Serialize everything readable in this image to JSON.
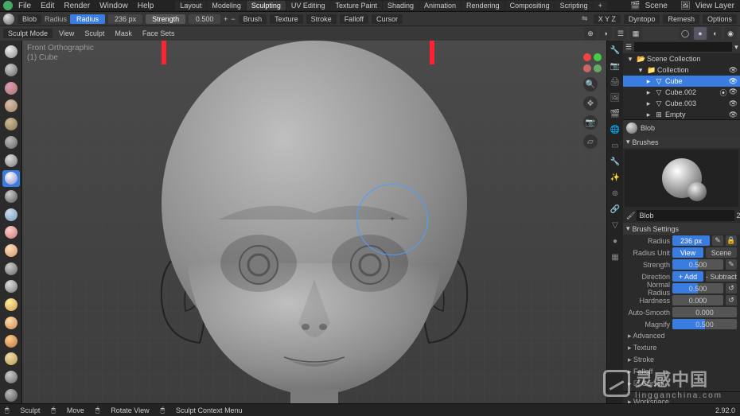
{
  "menu": {
    "items": [
      "File",
      "Edit",
      "Render",
      "Window",
      "Help"
    ]
  },
  "workspaces": {
    "tabs": [
      "Layout",
      "Modeling",
      "Sculpting",
      "UV Editing",
      "Texture Paint",
      "Shading",
      "Animation",
      "Rendering",
      "Compositing",
      "Scripting"
    ],
    "active": "Sculpting"
  },
  "topright": {
    "scene_label": "Scene",
    "scene": "Scene",
    "layer_label": "View Layer",
    "layer": "View Layer"
  },
  "toolhdr": {
    "mode": "Sculpt Mode",
    "menus": [
      "View",
      "Sculpt",
      "Mask",
      "Face Sets"
    ],
    "brush_name": "Blob",
    "radius_label": "Radius",
    "radius_value": "236 px",
    "strength_label": "Strength",
    "strength_value": "0.500",
    "dropdowns": [
      "Brush",
      "Texture",
      "Stroke",
      "Falloff",
      "Cursor"
    ],
    "xyz": "X Y Z",
    "dyntopo": "Dyntopo",
    "remesh": "Remesh",
    "options": "Options"
  },
  "overlay": {
    "line1": "Front Orthographic",
    "line2": "(1) Cube"
  },
  "viewport_nav": {
    "axes": [
      "red",
      "green"
    ]
  },
  "outliner": {
    "title": "Scene Collection",
    "rows": [
      {
        "indent": 1,
        "icon": "📁",
        "name": "Collection",
        "sel": false
      },
      {
        "indent": 2,
        "icon": "▽",
        "name": "Cube",
        "sel": true
      },
      {
        "indent": 2,
        "icon": "▽",
        "name": "Cube.002",
        "sel": false
      },
      {
        "indent": 2,
        "icon": "▽",
        "name": "Cube.003",
        "sel": false
      },
      {
        "indent": 2,
        "icon": "⊞",
        "name": "Empty",
        "sel": false
      }
    ]
  },
  "props": {
    "active_name": "Blob",
    "brushes_label": "Brushes",
    "brush_name": "Blob",
    "settings_label": "Brush Settings",
    "radius": {
      "label": "Radius",
      "value": "236 px"
    },
    "radius_unit": {
      "label": "Radius Unit",
      "a": "View",
      "b": "Scene"
    },
    "strength": {
      "label": "Strength",
      "value": "0.500"
    },
    "direction": {
      "label": "Direction",
      "a": "+  Add",
      "b": "-  Subtract"
    },
    "normal_radius": {
      "label": "Normal Radius",
      "value": "0.500"
    },
    "hardness": {
      "label": "Hardness",
      "value": "0.000"
    },
    "autosmooth": {
      "label": "Auto-Smooth",
      "value": "0.000"
    },
    "magnify": {
      "label": "Magnify",
      "value": "0.500"
    },
    "collapsed": [
      "Advanced",
      "Texture",
      "Stroke",
      "Falloff",
      "Cursor",
      "Workspace"
    ],
    "cursor_checked": true
  },
  "status": {
    "items": [
      "Sculpt",
      "Move",
      "",
      "Rotate View",
      "",
      "Sculpt Context Menu"
    ],
    "version": "2.92.0"
  },
  "watermark": {
    "main": "灵感中国",
    "sub": "lingganchina.com"
  }
}
